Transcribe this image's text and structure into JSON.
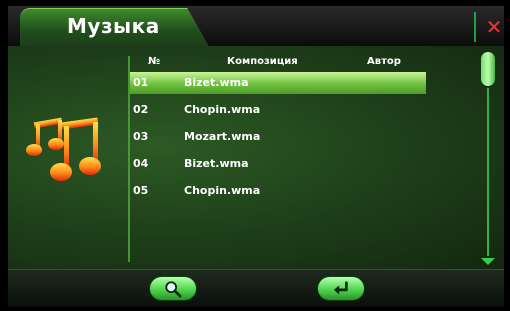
{
  "header": {
    "title": "Музыка"
  },
  "table": {
    "columns": {
      "num": "№",
      "title": "Композиция",
      "author": "Автор"
    },
    "rows": [
      {
        "num": "01",
        "title": "Bizet.wma",
        "selected": true
      },
      {
        "num": "02",
        "title": "Chopin.wma",
        "selected": false
      },
      {
        "num": "03",
        "title": "Mozart.wma",
        "selected": false
      },
      {
        "num": "04",
        "title": "Bizet.wma",
        "selected": false
      },
      {
        "num": "05",
        "title": "Chopin.wma",
        "selected": false
      }
    ]
  },
  "icons": {
    "close": "close-icon",
    "music": "music-notes-icon",
    "search": "search-icon",
    "back": "enter-back-icon"
  },
  "colors": {
    "accent_green": "#4fd64e",
    "close_red": "#e33333",
    "selected_row": "#6fc23d"
  }
}
